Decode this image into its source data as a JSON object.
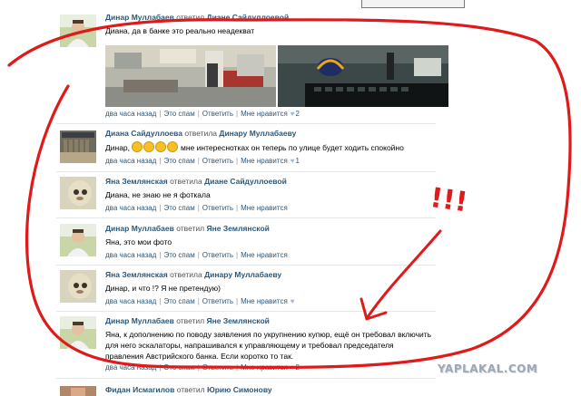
{
  "posts": [
    {
      "author": "Динар Муллабаев",
      "verb": "ответил",
      "target": "Диане Сайдуллоевой",
      "text": "Диана, да в банке это реально неадекват",
      "time": "два часа назад",
      "spam": "Это спам",
      "reply": "Ответить",
      "like": "Мне нравится",
      "likes": "2"
    },
    {
      "author": "Диана Сайдуллоева",
      "verb": "ответила",
      "target": "Динару Муллабаеву",
      "text_before": "Динар,",
      "text_after": "мне интереснотках он теперь по улице будет ходить спокойно",
      "time": "два часа назад",
      "spam": "Это спам",
      "reply": "Ответить",
      "like": "Мне нравится",
      "likes": "1"
    },
    {
      "author": "Яна Землянская",
      "verb": "ответила",
      "target": "Диане Сайдуллоевой",
      "text": "Диана, не знаю не я фоткала",
      "time": "два часа назад",
      "spam": "Это спам",
      "reply": "Ответить",
      "like": "Мне нравится"
    },
    {
      "author": "Динар Муллабаев",
      "verb": "ответил",
      "target": "Яне Землянской",
      "text": "Яна, это мои фото",
      "time": "два часа назад",
      "spam": "Это спам",
      "reply": "Ответить",
      "like": "Мне нравится"
    },
    {
      "author": "Яна Землянская",
      "verb": "ответила",
      "target": "Динару Муллабаеву",
      "text": "Динар, и что !? Я не претендую)",
      "time": "два часа назад",
      "spam": "Это спам",
      "reply": "Ответить",
      "like": "Мне нравится"
    },
    {
      "author": "Динар Муллабаев",
      "verb": "ответил",
      "target": "Яне Землянской",
      "text_line1": "Яна, к дополнению по поводу заявления по укрупнению купюр, ещё он требовал включить",
      "text_line2": "для него эскалаторы, напрашивался к управляющему и требовал председателя",
      "text_line3": "правления Австрийского банка. Если коротко то так.",
      "time": "два часа назад",
      "spam": "Это спам",
      "reply": "Ответить",
      "like": "Мне нравится",
      "likes": "2"
    },
    {
      "author": "Фидан Исмагилов",
      "verb": "ответил",
      "target": "Юрию Симонову"
    }
  ],
  "annotation": {
    "marks": "!!!",
    "color": "#e01a1a"
  },
  "watermark": "YAPLAKAL.COM",
  "colors": {
    "link": "#2b587a",
    "meta": "#999999",
    "divider": "#e4e8ee"
  }
}
